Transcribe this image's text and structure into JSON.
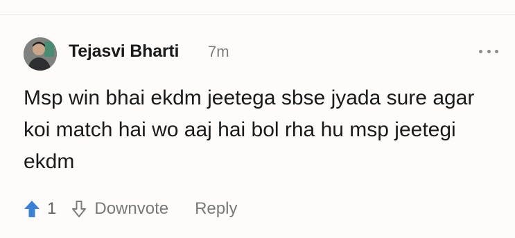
{
  "comment": {
    "author": "Tejasvi Bharti",
    "time": "7m",
    "avatar_icon": "user-avatar-photo",
    "more_icon": "more-options-icon",
    "body": "Msp win bhai ekdm jeetega sbse jyada sure agar koi match hai wo aaj hai bol rha hu msp jeetegi ekdm"
  },
  "actions": {
    "upvote_icon": "upvote-arrow-icon",
    "upvote_color": "#3b82d6",
    "vote_count": "1",
    "downvote_icon": "downvote-arrow-icon",
    "downvote_label": "Downvote",
    "reply_label": "Reply"
  }
}
